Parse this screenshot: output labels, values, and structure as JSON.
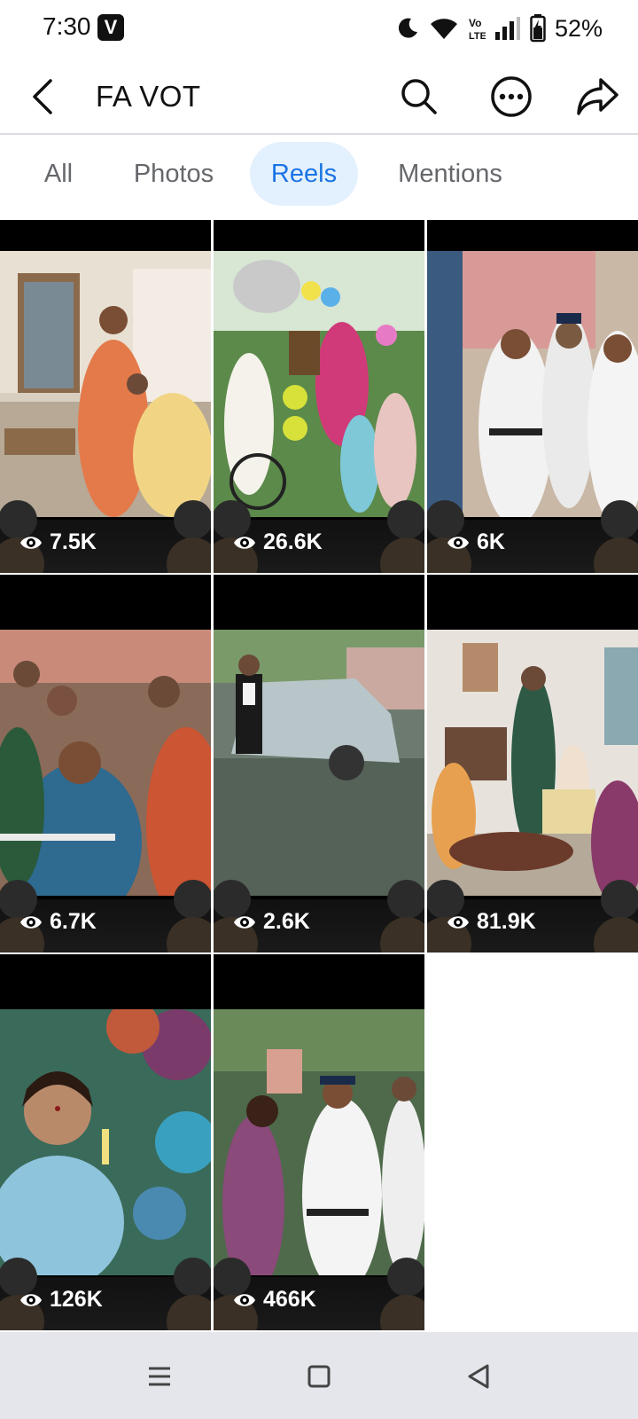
{
  "status_bar": {
    "time": "7:30",
    "badge": "V",
    "battery": "52%",
    "icons": [
      "do-not-disturb-moon-icon",
      "wifi-icon",
      "volte-icon",
      "signal-icon",
      "battery-charging-icon"
    ]
  },
  "header": {
    "title": "FA VOT",
    "icons": [
      "back-arrow-icon",
      "search-icon",
      "more-options-icon",
      "share-icon"
    ]
  },
  "tabs": [
    {
      "label": "All",
      "active": false
    },
    {
      "label": "Photos",
      "active": false
    },
    {
      "label": "Reels",
      "active": true
    },
    {
      "label": "Mentions",
      "active": false
    }
  ],
  "reels": [
    {
      "views": "7.5K",
      "scene": "living-room-saree"
    },
    {
      "views": "26.6K",
      "scene": "balloons-megaphone"
    },
    {
      "views": "6K",
      "scene": "police-women"
    },
    {
      "views": "6.7K",
      "scene": "protest-crowd"
    },
    {
      "views": "2.6K",
      "scene": "man-by-car"
    },
    {
      "views": "81.9K",
      "scene": "family-living-room"
    },
    {
      "views": "126K",
      "scene": "woman-blue-saree"
    },
    {
      "views": "466K",
      "scene": "police-crowd"
    }
  ],
  "nav_bar": {
    "icons": [
      "recent-apps-icon",
      "home-icon",
      "back-icon"
    ]
  },
  "colors": {
    "accent": "#1a74e4",
    "active_tab_bg": "#e3f0fd",
    "tab_inactive": "#65676b",
    "nav_bg": "#e4e6eb"
  }
}
